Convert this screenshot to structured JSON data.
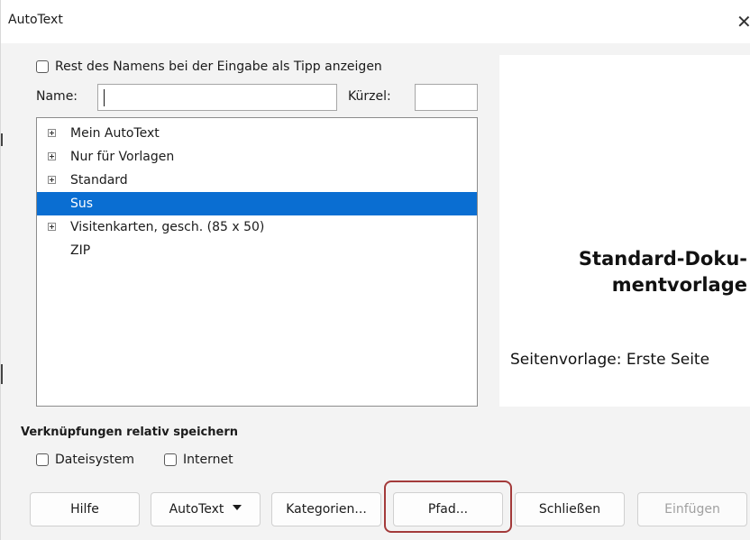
{
  "window": {
    "title": "AutoText",
    "close_glyph": "✕"
  },
  "tip_checkbox": {
    "label": "Rest des Namens bei der Eingabe als Tipp anzeigen",
    "checked": false
  },
  "name_field": {
    "label": "Name:",
    "value": ""
  },
  "shortcut_field": {
    "label": "Kürzel:",
    "value": ""
  },
  "tree": {
    "items": [
      {
        "label": "Mein AutoText",
        "expandable": true,
        "selected": false
      },
      {
        "label": "Nur für Vorlagen",
        "expandable": true,
        "selected": false
      },
      {
        "label": "Standard",
        "expandable": true,
        "selected": false
      },
      {
        "label": "Sus",
        "expandable": false,
        "selected": true
      },
      {
        "label": "Visitenkarten, gesch. (85 x 50)",
        "expandable": true,
        "selected": false
      },
      {
        "label": "ZIP",
        "expandable": false,
        "selected": false
      }
    ]
  },
  "preview": {
    "title_line1": "Standard-Doku-",
    "title_line2": "mentvorlage",
    "subtitle": "Seitenvorlage: Erste Seite"
  },
  "relative_links": {
    "heading": "Verknüpfungen relativ speichern",
    "filesystem_label": "Dateisystem",
    "internet_label": "Internet"
  },
  "buttons": {
    "help": "Hilfe",
    "autotext": "AutoText",
    "categories": "Kategorien...",
    "path": "Pfad...",
    "close": "Schließen",
    "insert": "Einfügen"
  },
  "colors": {
    "selection": "#0a6ed2",
    "highlight_ring": "#a33a3a",
    "disabled_text": "#a0a0a0"
  }
}
